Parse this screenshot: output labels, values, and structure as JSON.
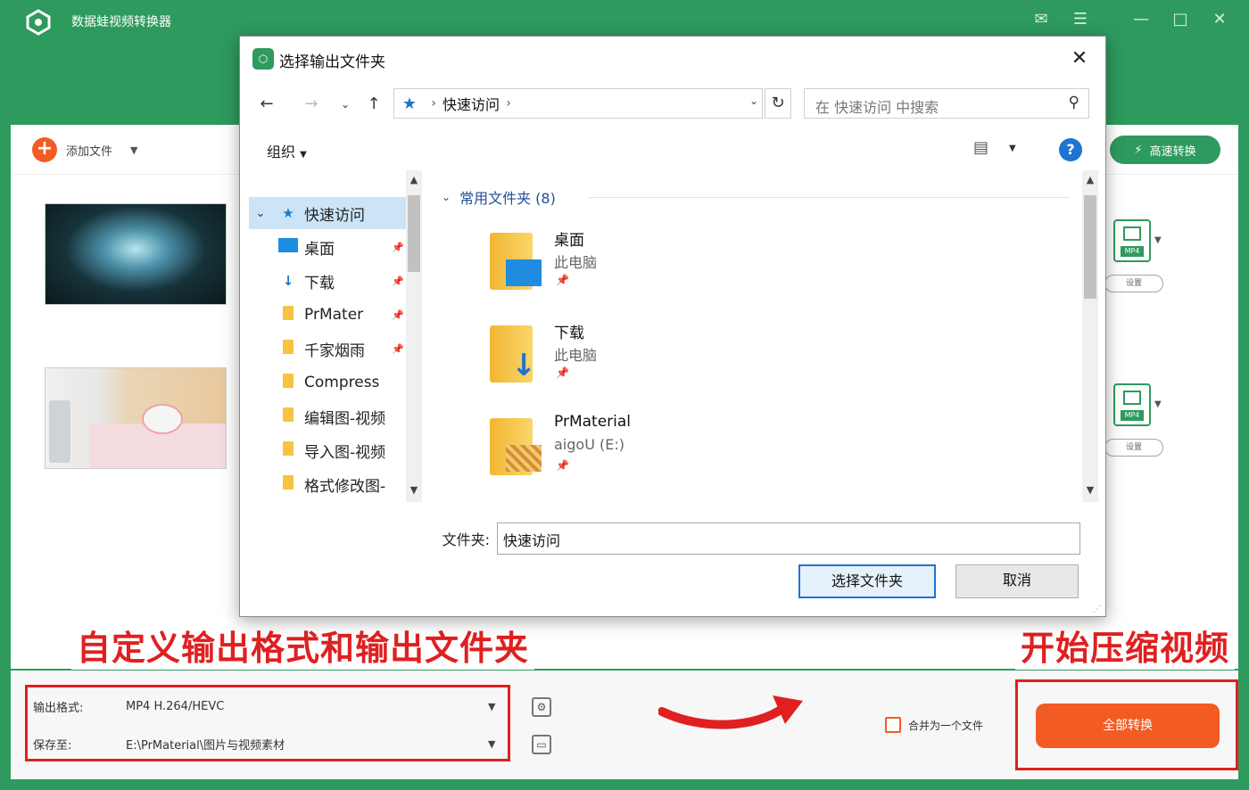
{
  "app": {
    "title": "数据蛙视频转换器",
    "add_file_label": "添加文件",
    "fast_convert_label": "高速转换",
    "format_tag": "MP4",
    "format_small_btn": "设置"
  },
  "dialog": {
    "title": "选择输出文件夹",
    "address": "快速访问",
    "search_placeholder": "在 快速访问 中搜索",
    "organize_label": "组织",
    "nav": {
      "quick_access": "快速访问",
      "items": [
        "桌面",
        "下载",
        "PrMater",
        "千家烟雨",
        "Compress",
        "编辑图-视频",
        "导入图-视频",
        "格式修改图-"
      ]
    },
    "group_header": "常用文件夹 (8)",
    "folders": [
      {
        "name": "桌面",
        "location": "此电脑"
      },
      {
        "name": "下载",
        "location": "此电脑"
      },
      {
        "name": "PrMaterial",
        "location": "aigoU (E:)"
      }
    ],
    "folder_label": "文件夹:",
    "folder_value": "快速访问",
    "select_button": "选择文件夹",
    "cancel_button": "取消"
  },
  "annotations": {
    "left": "自定义输出格式和输出文件夹",
    "right": "开始压缩视频"
  },
  "bottom": {
    "output_format_label": "输出格式:",
    "output_format_value": "MP4 H.264/HEVC",
    "save_to_label": "保存至:",
    "save_to_value": "E:\\PrMaterial\\图片与视频素材",
    "merge_label": "合并为一个文件",
    "convert_all_label": "全部转换"
  }
}
